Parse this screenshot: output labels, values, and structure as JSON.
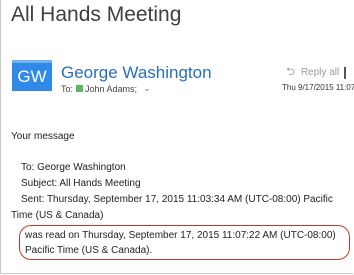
{
  "message": {
    "subject": "All Hands Meeting",
    "avatar_initials": "GW",
    "sender_name": "George Washington",
    "to_label": "To:",
    "recipient": "John Adams;",
    "reply_all_label": "Reply all",
    "date_time": "Thu 9/17/2015 11:07",
    "body": {
      "greeting": "Your message",
      "to_line": "To: George Washington",
      "subject_line": "Subject: All Hands Meeting",
      "sent_line_1": "Sent: Thursday, September 17, 2015 11:03:34 AM (UTC-08:00) Pacific",
      "sent_line_2": "Time (US & Canada)",
      "read_line_1": "was read on Thursday, September 17, 2015 11:07:22 AM (UTC-08:00)",
      "read_line_2": "Pacific Time (US & Canada)."
    }
  },
  "colors": {
    "avatar_bg": "#2e8ae6",
    "sender": "#2a6ebb",
    "presence": "#5cb85c",
    "highlight_outline": "#c0392b"
  },
  "icons": {
    "reply_all": "reply-all-icon",
    "expand": "chevron-down-icon",
    "presence": "presence-status-icon"
  }
}
